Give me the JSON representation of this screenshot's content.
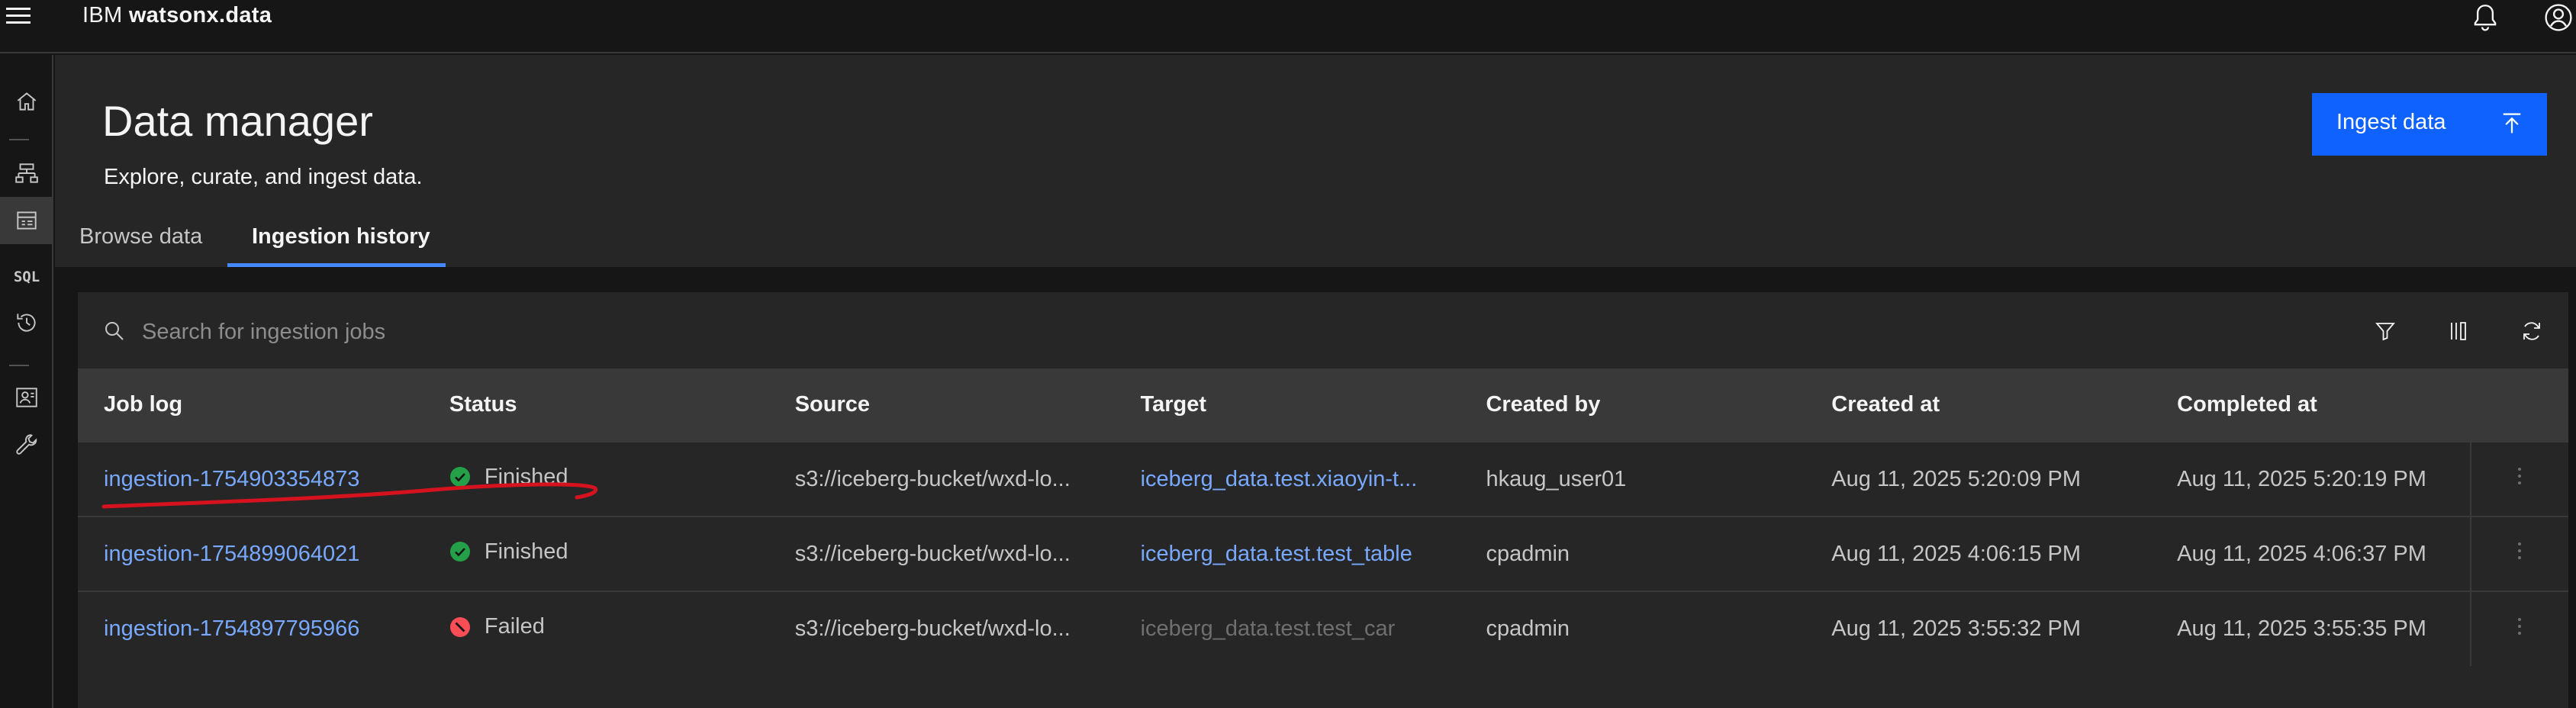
{
  "header": {
    "brand_prefix": "IBM",
    "brand_product": "watsonx.data"
  },
  "rail": {
    "items": [
      "home-icon",
      "infrastructure-icon",
      "data-manager-icon",
      "SQL",
      "history-icon",
      "access-control-icon",
      "configurations-icon"
    ]
  },
  "page": {
    "title": "Data manager",
    "subtitle": "Explore, curate, and ingest data.",
    "ingest_button": "Ingest data"
  },
  "tabs": [
    {
      "label": "Browse data",
      "selected": false
    },
    {
      "label": "Ingestion history",
      "selected": true
    }
  ],
  "search": {
    "placeholder": "Search for ingestion jobs"
  },
  "table": {
    "columns": [
      "Job log",
      "Status",
      "Source",
      "Target",
      "Created by",
      "Created at",
      "Completed at"
    ],
    "rows": [
      {
        "job": "ingestion-1754903354873",
        "status": "Finished",
        "status_kind": "success",
        "source": "s3://iceberg-bucket/wxd-lo...",
        "target": "iceberg_data.test.xiaoyin-t...",
        "target_link": true,
        "created_by": "hkaug_user01",
        "created_at": "Aug 11, 2025 5:20:09 PM",
        "completed_at": "Aug 11, 2025 5:20:19 PM"
      },
      {
        "job": "ingestion-1754899064021",
        "status": "Finished",
        "status_kind": "success",
        "source": "s3://iceberg-bucket/wxd-lo...",
        "target": "iceberg_data.test.test_table",
        "target_link": true,
        "created_by": "cpadmin",
        "created_at": "Aug 11, 2025 4:06:15 PM",
        "completed_at": "Aug 11, 2025 4:06:37 PM"
      },
      {
        "job": "ingestion-1754897795966",
        "status": "Failed",
        "status_kind": "error",
        "source": "s3://iceberg-bucket/wxd-lo...",
        "target": "iceberg_data.test.test_car",
        "target_link": false,
        "created_by": "cpadmin",
        "created_at": "Aug 11, 2025 3:55:32 PM",
        "completed_at": "Aug 11, 2025 3:55:35 PM"
      }
    ]
  },
  "colors": {
    "accent": "#0f62fe",
    "link": "#78a9ff",
    "success": "#24a148",
    "error": "#fa4d56",
    "annotation": "#d6121f"
  }
}
